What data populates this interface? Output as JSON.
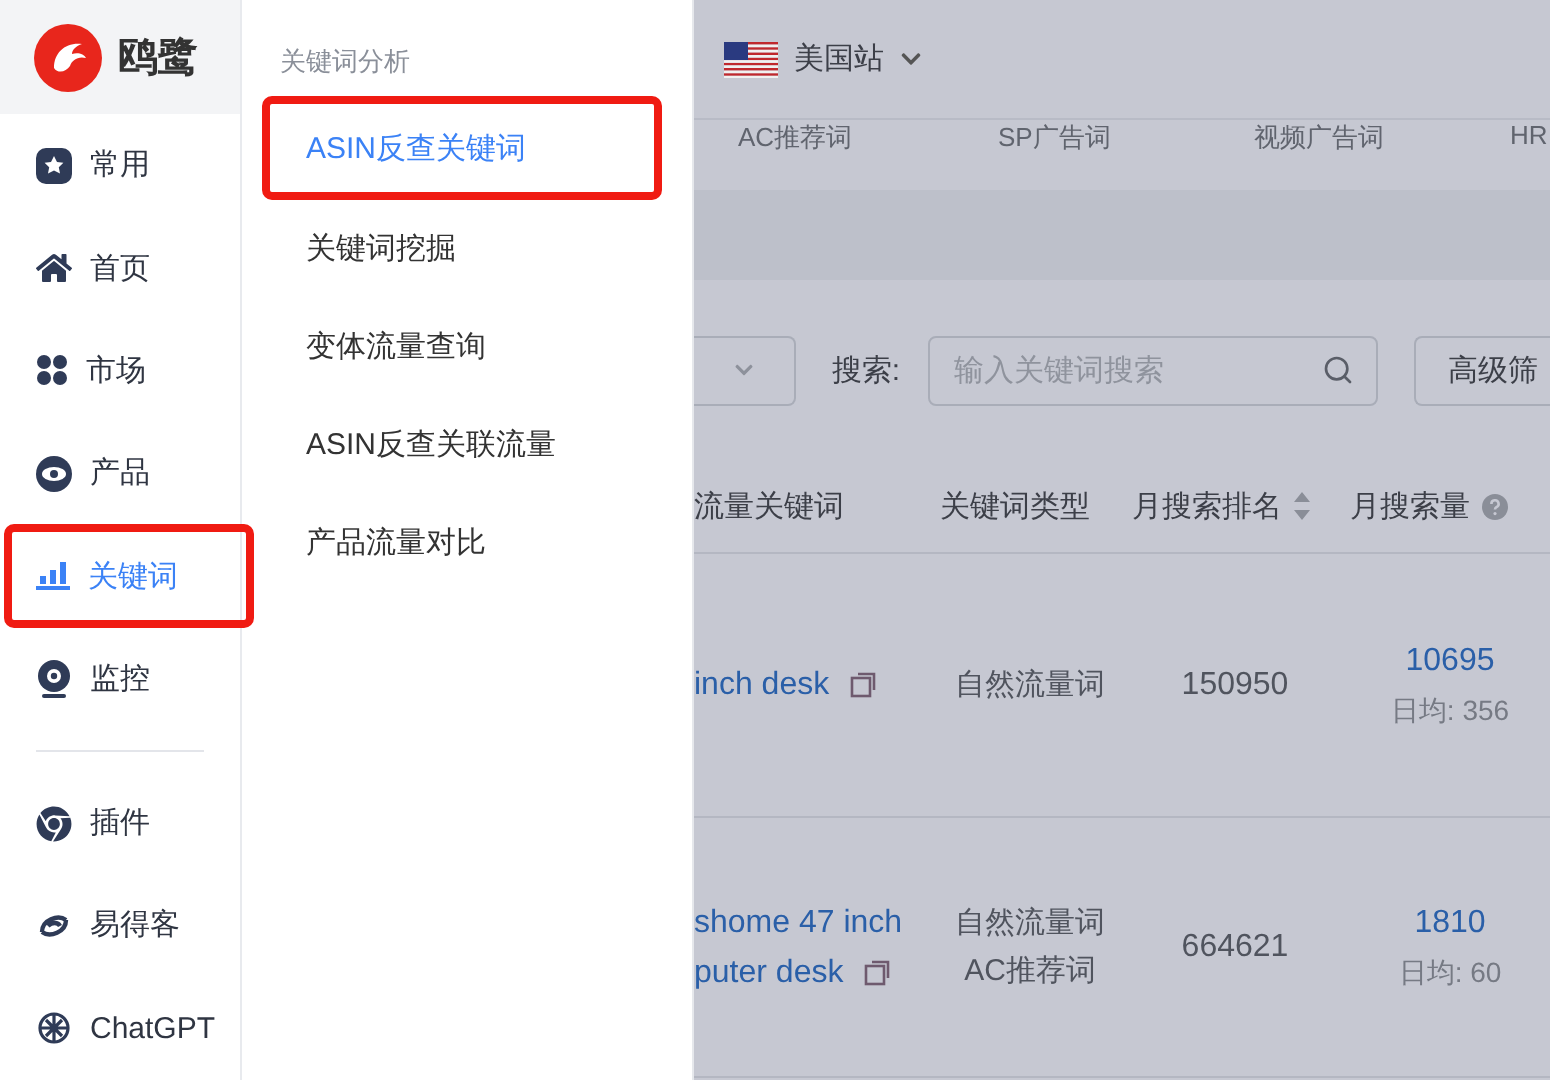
{
  "logo": {
    "name": "鸥鹭"
  },
  "sidebar": {
    "items": [
      {
        "label": "常用",
        "selected": false,
        "highlighted": false
      },
      {
        "label": "首页",
        "selected": false,
        "highlighted": false
      },
      {
        "label": "市场",
        "selected": false,
        "highlighted": false
      },
      {
        "label": "产品",
        "selected": false,
        "highlighted": false
      },
      {
        "label": "关键词",
        "selected": true,
        "highlighted": true
      },
      {
        "label": "监控",
        "selected": false,
        "highlighted": false
      }
    ],
    "tool_items": [
      {
        "label": "插件",
        "selected": false,
        "highlighted": false
      },
      {
        "label": "易得客",
        "selected": false,
        "highlighted": false
      },
      {
        "label": "ChatGPT",
        "selected": false,
        "highlighted": false
      }
    ]
  },
  "submenu": {
    "heading": "关键词分析",
    "items": [
      {
        "label": "ASIN反查关键词",
        "selected": true,
        "highlighted": true
      },
      {
        "label": "关键词挖掘",
        "selected": false,
        "highlighted": false
      },
      {
        "label": "变体流量查询",
        "selected": false,
        "highlighted": false
      },
      {
        "label": "ASIN反查关联流量",
        "selected": false,
        "highlighted": false
      },
      {
        "label": "产品流量对比",
        "selected": false,
        "highlighted": false
      }
    ]
  },
  "topbar": {
    "site": "美国站"
  },
  "tabs": [
    {
      "label": "AC推荐词"
    },
    {
      "label": "SP广告词"
    },
    {
      "label": "视频广告词"
    },
    {
      "label": "HR"
    }
  ],
  "filters": {
    "search_label": "搜索:",
    "search_placeholder": "输入关键词搜索",
    "advanced_button": "高级筛"
  },
  "table": {
    "columns": [
      {
        "label": "流量关键词",
        "sortable": false,
        "help": false
      },
      {
        "label": "关键词类型",
        "sortable": false,
        "help": false
      },
      {
        "label": "月搜索排名",
        "sortable": true,
        "help": false
      },
      {
        "label": "月搜索量",
        "sortable": false,
        "help": true
      }
    ],
    "rows": [
      {
        "keyword": [
          "inch desk"
        ],
        "types": [
          "自然流量词"
        ],
        "rank": "150950",
        "volume": "10695",
        "daily": "日均: 356"
      },
      {
        "keyword": [
          "shome 47 inch",
          "puter desk"
        ],
        "types": [
          "自然流量词",
          "AC推荐词"
        ],
        "rank": "664621",
        "volume": "1810",
        "daily": "日均: 60"
      }
    ]
  }
}
